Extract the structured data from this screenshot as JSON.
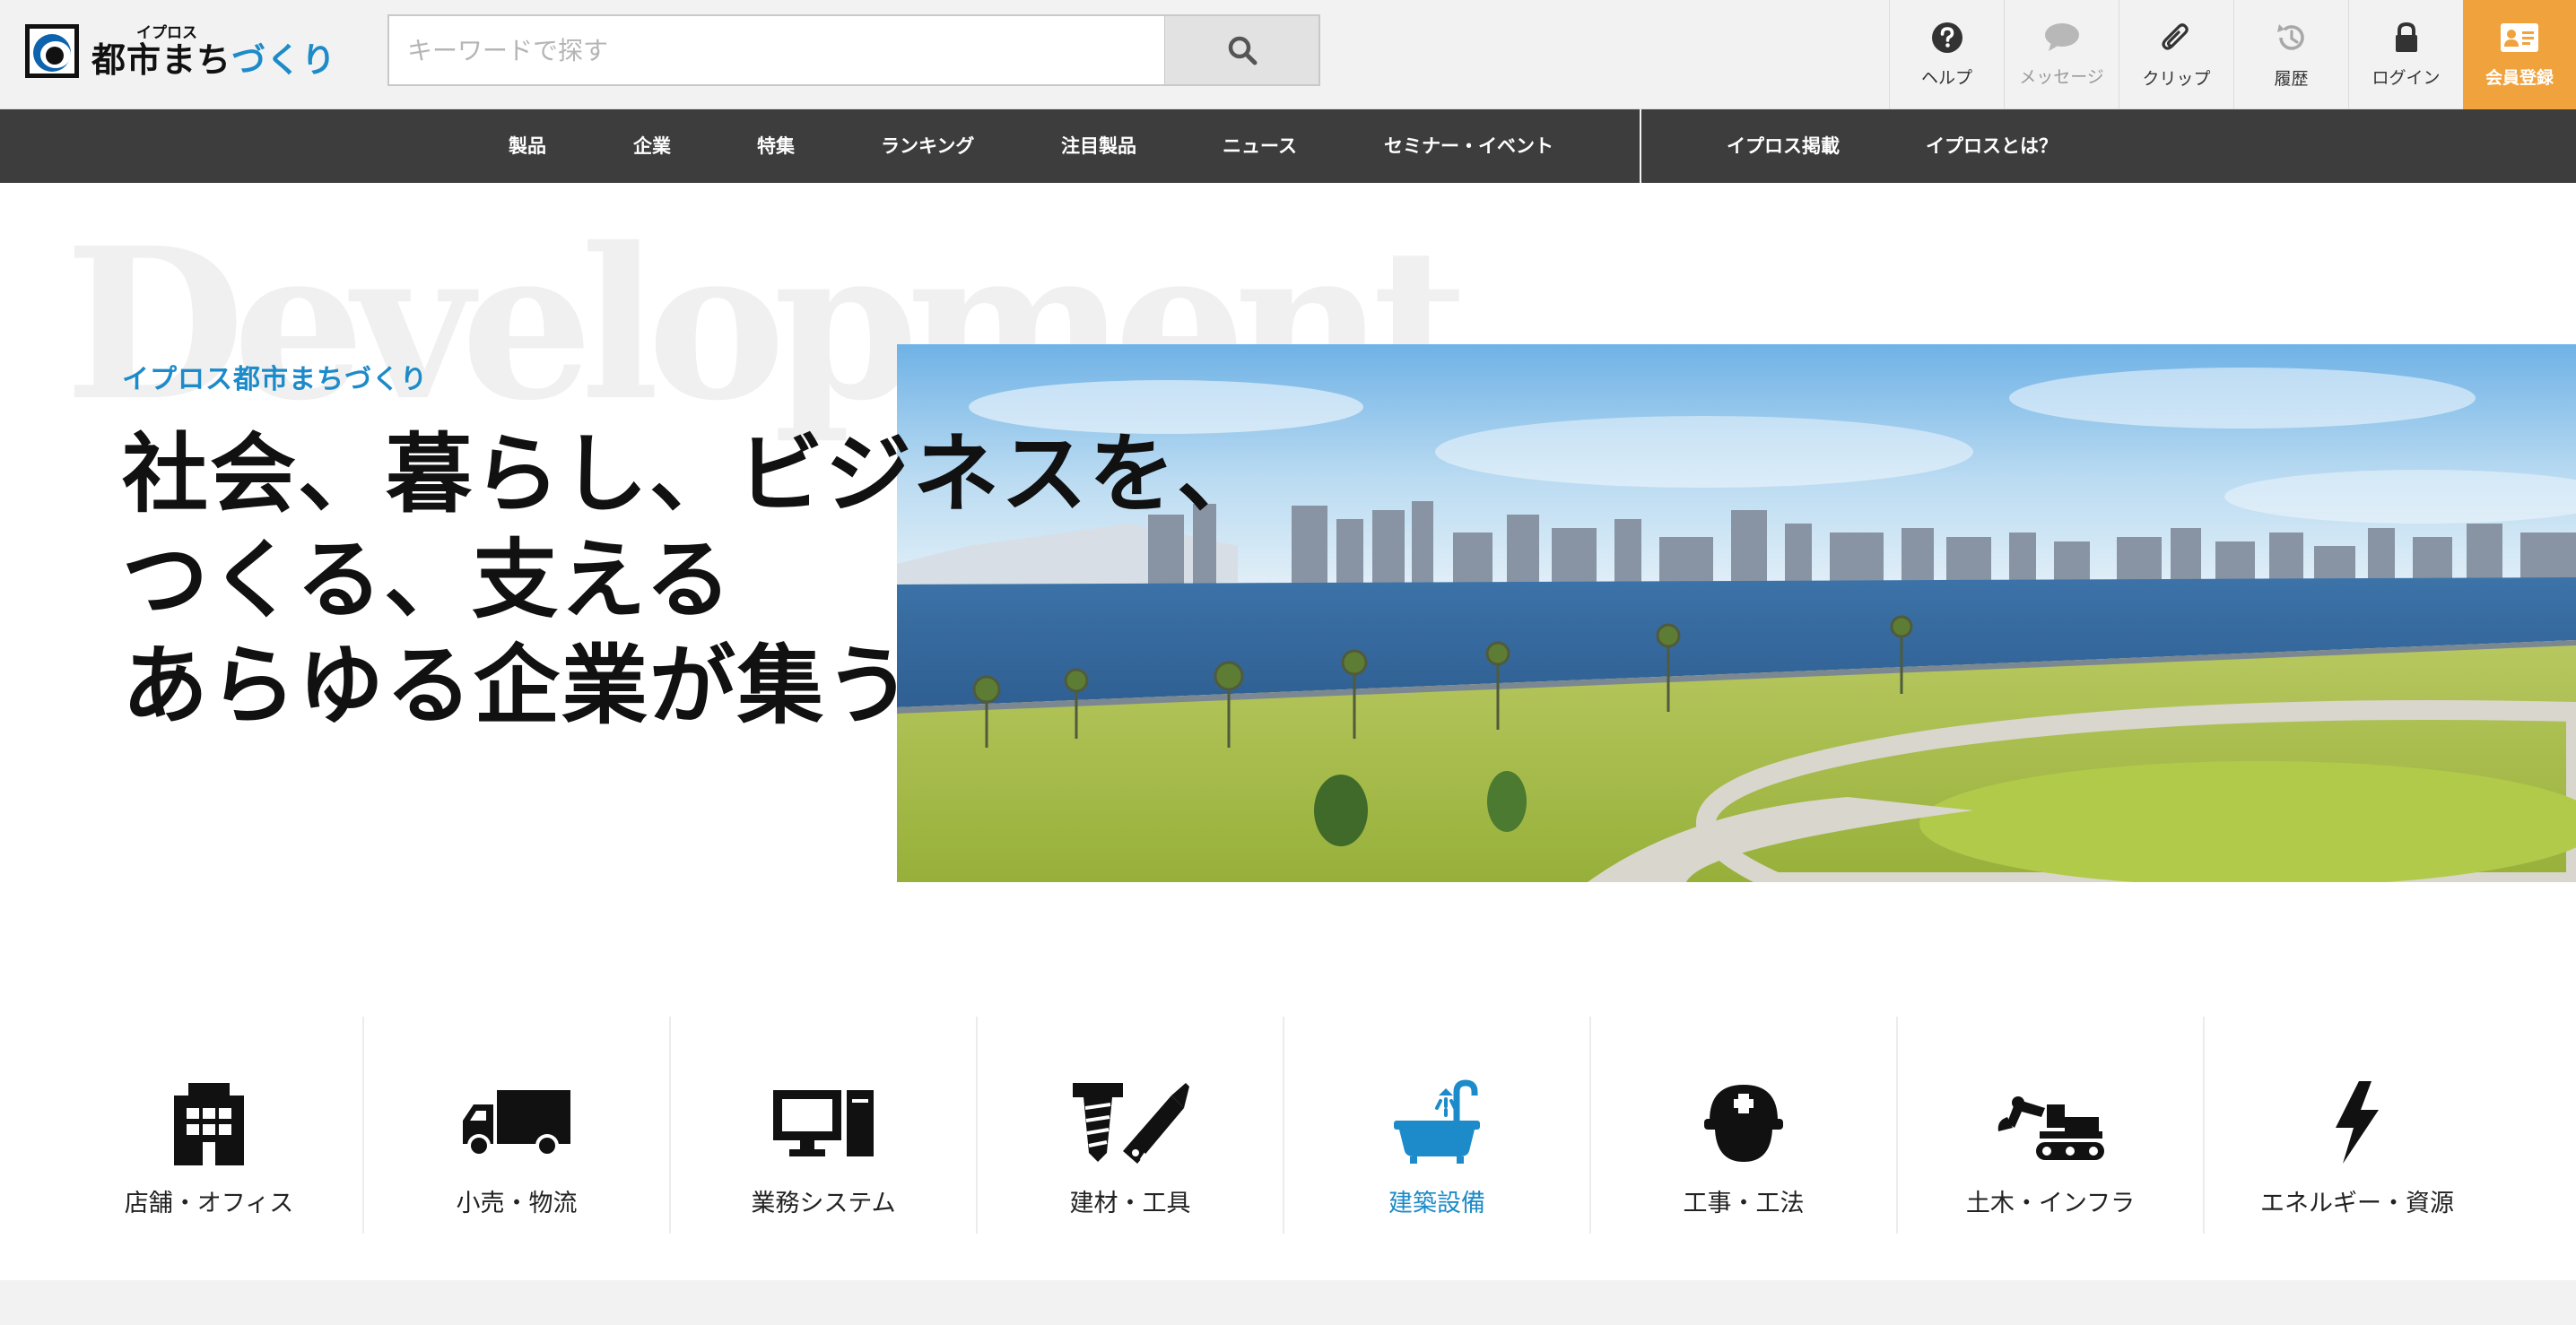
{
  "header": {
    "logo_small": "イプロス",
    "logo_main_a": "都市まち",
    "logo_main_b": "づくり",
    "search_placeholder": "キーワードで探す",
    "tools": [
      {
        "label": "ヘルプ",
        "icon": "help-icon"
      },
      {
        "label": "メッセージ",
        "icon": "message-icon"
      },
      {
        "label": "クリップ",
        "icon": "paperclip-icon"
      },
      {
        "label": "履歴",
        "icon": "history-icon"
      },
      {
        "label": "ログイン",
        "icon": "lock-icon"
      },
      {
        "label": "会員登録",
        "icon": "member-card-icon"
      }
    ]
  },
  "nav": {
    "items": [
      "製品",
      "企業",
      "特集",
      "ランキング",
      "注目製品",
      "ニュース",
      "セミナー・イベント"
    ],
    "right_items": [
      "イプロス掲載",
      "イプロスとは？"
    ]
  },
  "hero": {
    "watermark": "Development",
    "eyebrow": "イプロス都市まちづくり",
    "headline_lines": [
      "社会、暮らし、ビジネスを、",
      "つくる、支える",
      "あらゆる企業が集う"
    ]
  },
  "categories": [
    {
      "label": "店舗・オフィス",
      "icon": "building-icon"
    },
    {
      "label": "小売・物流",
      "icon": "truck-icon"
    },
    {
      "label": "業務システム",
      "icon": "computer-icon"
    },
    {
      "label": "建材・工具",
      "icon": "tools-icon"
    },
    {
      "label": "建築設備",
      "icon": "bathtub-icon",
      "active": true
    },
    {
      "label": "工事・工法",
      "icon": "hardhat-icon"
    },
    {
      "label": "土木・インフラ",
      "icon": "excavator-icon"
    },
    {
      "label": "エネルギー・資源",
      "icon": "lightning-icon"
    }
  ],
  "colors": {
    "accent": "#1d8bc9",
    "register": "#f0a23d",
    "nav_bg": "#3d3d3d"
  }
}
